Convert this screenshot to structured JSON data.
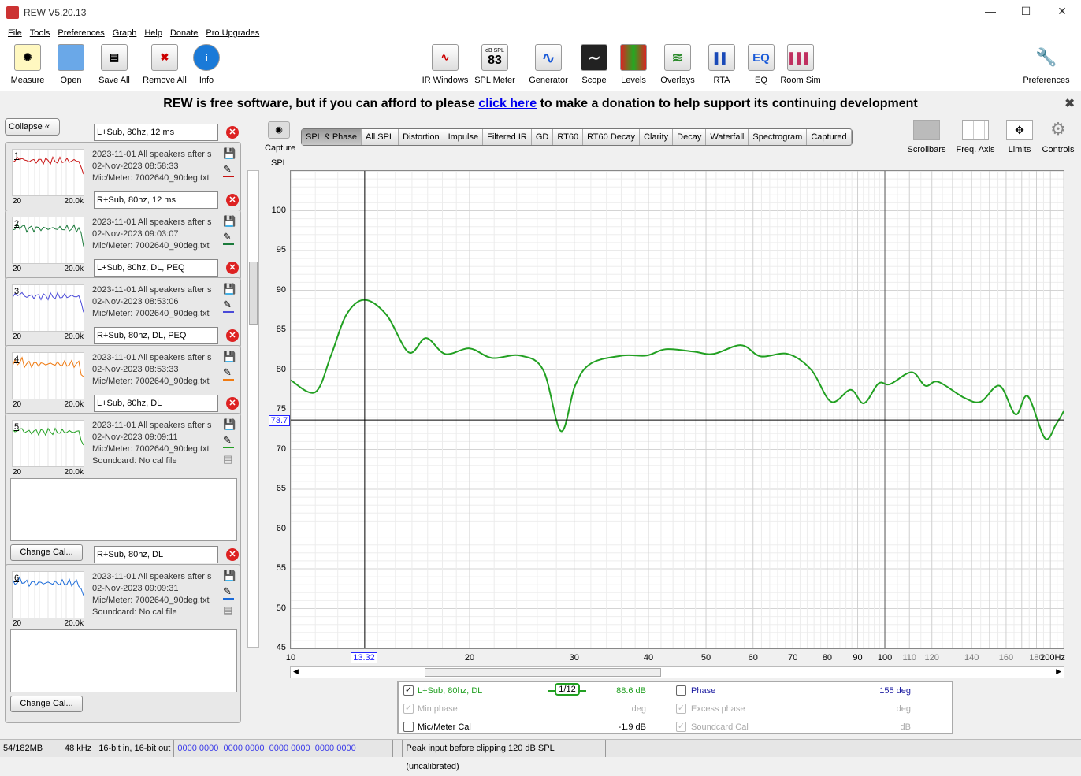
{
  "window": {
    "title": "REW V5.20.13",
    "minimize": "—",
    "maximize": "☐",
    "close": "✕"
  },
  "menu": [
    "File",
    "Tools",
    "Preferences",
    "Graph",
    "Help",
    "Donate",
    "Pro Upgrades"
  ],
  "toolbar_left": [
    {
      "label": "Measure",
      "icon": "measure-icon"
    },
    {
      "label": "Open",
      "icon": "folder-icon"
    },
    {
      "label": "Save All",
      "icon": "save-icon"
    },
    {
      "label": "Remove All",
      "icon": "remove-icon"
    },
    {
      "label": "Info",
      "icon": "info-icon"
    }
  ],
  "toolbar_center": [
    {
      "label": "IR Windows",
      "glyph": "∿"
    },
    {
      "label": "SPL Meter",
      "glyph": "83",
      "sub": "dB SPL"
    },
    {
      "label": "Generator",
      "glyph": "∿"
    },
    {
      "label": "Scope",
      "glyph": "∼"
    },
    {
      "label": "Levels",
      "glyph": "▮▮"
    },
    {
      "label": "Overlays",
      "glyph": "≋"
    },
    {
      "label": "RTA",
      "glyph": "▌▌"
    },
    {
      "label": "EQ",
      "glyph": "EQ"
    },
    {
      "label": "Room Sim",
      "glyph": "▌▌▌"
    }
  ],
  "preferences_label": "Preferences",
  "donate": {
    "before": "REW is free software, but if you can afford to please ",
    "link": "click here",
    "after": " to make a donation to help support its continuing development",
    "close": "✖"
  },
  "collapse_label": "Collapse",
  "measurements": [
    {
      "num": "1",
      "name": "L+Sub, 80hz, 12 ms",
      "line1": "2023-11-01 All speakers after s",
      "line2": "02-Nov-2023 08:58:33",
      "line3": "Mic/Meter: 7002640_90deg.txt",
      "color": "#c81010"
    },
    {
      "num": "2",
      "name": "R+Sub, 80hz, 12 ms",
      "line1": "2023-11-01 All speakers after s",
      "line2": "02-Nov-2023 09:03:07",
      "line3": "Mic/Meter: 7002640_90deg.txt",
      "color": "#1a7a3a"
    },
    {
      "num": "3",
      "name": "L+Sub, 80hz, DL, PEQ",
      "line1": "2023-11-01 All speakers after s",
      "line2": "02-Nov-2023 08:53:06",
      "line3": "Mic/Meter: 7002640_90deg.txt",
      "color": "#4a4ad8"
    },
    {
      "num": "4",
      "name": "R+Sub, 80hz, DL, PEQ",
      "line1": "2023-11-01 All speakers after s",
      "line2": "02-Nov-2023 08:53:33",
      "line3": "Mic/Meter: 7002640_90deg.txt",
      "color": "#f07a10"
    },
    {
      "num": "5",
      "name": "L+Sub, 80hz, DL",
      "line1": "2023-11-01 All speakers after s",
      "line2": "02-Nov-2023 09:09:11",
      "line3": "Mic/Meter: 7002640_90deg.txt",
      "line4": "Soundcard: No cal file",
      "color": "#22a022"
    },
    {
      "num": "6",
      "name": "R+Sub, 80hz, DL",
      "line1": "2023-11-01 All speakers after s",
      "line2": "02-Nov-2023 09:09:31",
      "line3": "Mic/Meter: 7002640_90deg.txt",
      "line4": "Soundcard: No cal file",
      "color": "#1a6ad8"
    }
  ],
  "thumb_axis": {
    "min": "20",
    "max": "20.0k"
  },
  "change_cal_label": "Change Cal...",
  "capture_label": "Capture",
  "tabs": [
    "SPL & Phase",
    "All SPL",
    "Distortion",
    "Impulse",
    "Filtered IR",
    "GD",
    "RT60",
    "RT60 Decay",
    "Clarity",
    "Decay",
    "Waterfall",
    "Spectrogram",
    "Captured"
  ],
  "active_tab": "SPL & Phase",
  "right_tools": [
    "Scrollbars",
    "Freq. Axis",
    "Limits",
    "Controls"
  ],
  "chart_data": {
    "type": "line",
    "ylabel": "SPL",
    "xscale": "log",
    "xlim": [
      10,
      200
    ],
    "ylim": [
      45,
      105
    ],
    "grid": true,
    "yticks": [
      45,
      50,
      55,
      60,
      65,
      70,
      75,
      80,
      85,
      90,
      95,
      100
    ],
    "xticks": [
      {
        "v": 10,
        "l": "10"
      },
      {
        "v": 20,
        "l": "20"
      },
      {
        "v": 30,
        "l": "30"
      },
      {
        "v": 40,
        "l": "40"
      },
      {
        "v": 50,
        "l": "50"
      },
      {
        "v": 60,
        "l": "60"
      },
      {
        "v": 70,
        "l": "70"
      },
      {
        "v": 80,
        "l": "80"
      },
      {
        "v": 90,
        "l": "90"
      },
      {
        "v": 100,
        "l": "100"
      },
      {
        "v": 110,
        "l": "110"
      },
      {
        "v": 120,
        "l": "120"
      },
      {
        "v": 140,
        "l": "140"
      },
      {
        "v": 160,
        "l": "160"
      },
      {
        "v": 180,
        "l": "180"
      },
      {
        "v": 200,
        "l": "200Hz"
      }
    ],
    "cursor": {
      "x": 13.32,
      "y": 73.7,
      "x_label": "13.32",
      "y_label": "73.7"
    },
    "series": [
      {
        "name": "L+Sub, 80hz, DL",
        "color": "#22a022",
        "x": [
          10,
          11,
          11.7,
          12.4,
          13.3,
          14.5,
          15.8,
          16.9,
          18.2,
          20,
          21.8,
          24.3,
          26.6,
          28.5,
          30.1,
          32,
          36.2,
          39.7,
          42.8,
          47.6,
          51.4,
          57.3,
          61.8,
          68.7,
          75.2,
          81.2,
          87.6,
          92.2,
          97.6,
          102,
          111,
          117,
          123,
          136,
          145,
          156,
          166,
          174,
          186,
          194,
          200
        ],
        "y": [
          78.7,
          77.2,
          81.9,
          86.9,
          88.8,
          86.9,
          82.2,
          84.0,
          82.0,
          82.7,
          81.5,
          81.8,
          80.0,
          72.3,
          78.0,
          80.8,
          81.8,
          81.8,
          82.6,
          82.3,
          82.0,
          83.1,
          81.7,
          82.0,
          80.0,
          76.0,
          77.5,
          75.8,
          78.3,
          78.2,
          79.7,
          78.0,
          78.5,
          76.5,
          76.0,
          78.0,
          74.4,
          76.7,
          71.4,
          73.1,
          74.8
        ]
      }
    ]
  },
  "legend": {
    "trace": {
      "label": "L+Sub, 80hz, DL",
      "smoothing": "1/12",
      "value": "88.6 dB",
      "checked": true
    },
    "min_phase": {
      "label": "Min phase",
      "value": "deg"
    },
    "mic_cal": {
      "label": "Mic/Meter Cal",
      "value": "-1.9 dB"
    },
    "phase": {
      "label": "Phase",
      "value": "155 deg"
    },
    "excess_phase": {
      "label": "Excess phase",
      "value": "deg"
    },
    "soundcard_cal": {
      "label": "Soundcard Cal",
      "value": "dB"
    }
  },
  "status": {
    "memory": "54/182MB",
    "rate": "48 kHz",
    "bits": "16-bit in, 16-bit out",
    "levels": "0000 0000  0000 0000  0000 0000  0000 0000",
    "peak": "Peak input before clipping 120 dB SPL (uncalibrated)"
  }
}
